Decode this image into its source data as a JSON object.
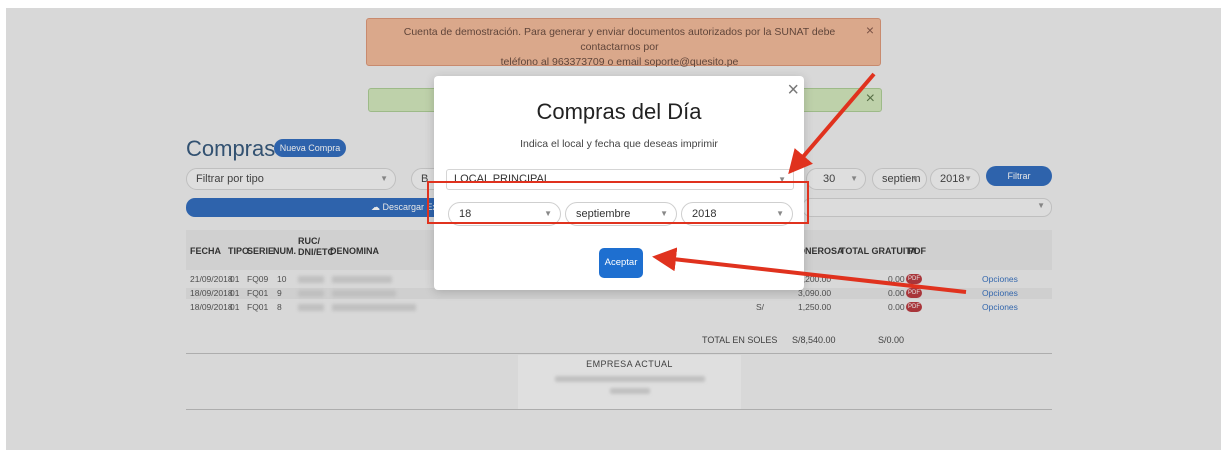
{
  "alert": {
    "line1": "Cuenta de demostración. Para generar y enviar documentos autorizados por la SUNAT debe contactarnos por",
    "line2": "teléfono al 963373709 o email soporte@quesito.pe",
    "close": "×"
  },
  "success_alert": {
    "close": "×"
  },
  "page": {
    "title": "Compras",
    "new_button": "Nueva Compra",
    "filter_type": "Filtrar por tipo",
    "buscar_stub": "B",
    "day": "30",
    "month": "septiem",
    "year": "2018",
    "filter_button": "Filtrar",
    "download_excel": "Descargar Ex"
  },
  "table": {
    "headers": {
      "fecha": "FECHA",
      "tipo": "TIPO",
      "serie": "SERIE",
      "num": "NUM.",
      "ruc": "RUC/ DNI/ETC",
      "denomina": "DENOMINA",
      "onerosa": "ONEROSA",
      "total_gratuita": "TOTAL GRATUITA",
      "pdf": "PDF"
    },
    "rows": [
      {
        "fecha": "21/09/2018",
        "tipo": "01",
        "serie": "FQ09",
        "num": "10",
        "moneda": "",
        "onerosa": "4,200.00",
        "gratuita": "0.00",
        "pdf": "PDF",
        "opciones": "Opciones"
      },
      {
        "fecha": "18/09/2018",
        "tipo": "01",
        "serie": "FQ01",
        "num": "9",
        "moneda": "",
        "onerosa": "3,090.00",
        "gratuita": "0.00",
        "pdf": "PDF",
        "opciones": "Opciones"
      },
      {
        "fecha": "18/09/2018",
        "tipo": "01",
        "serie": "FQ01",
        "num": "8",
        "moneda": "S/",
        "onerosa": "1,250.00",
        "gratuita": "0.00",
        "pdf": "PDF",
        "opciones": "Opciones"
      }
    ],
    "totals": {
      "label": "TOTAL EN SOLES",
      "onerosa": "S/8,540.00",
      "gratuita": "S/0.00"
    }
  },
  "footer": {
    "empresa_label": "EMPRESA ACTUAL"
  },
  "modal": {
    "title": "Compras del Día",
    "subtitle": "Indica el local y fecha que deseas imprimir",
    "local": "LOCAL PRINCIPAL",
    "day": "18",
    "month": "septiembre",
    "year": "2018",
    "accept": "Aceptar",
    "close": "×"
  },
  "colors": {
    "annotation": "#e0321e",
    "primary": "#1e5fb8"
  }
}
